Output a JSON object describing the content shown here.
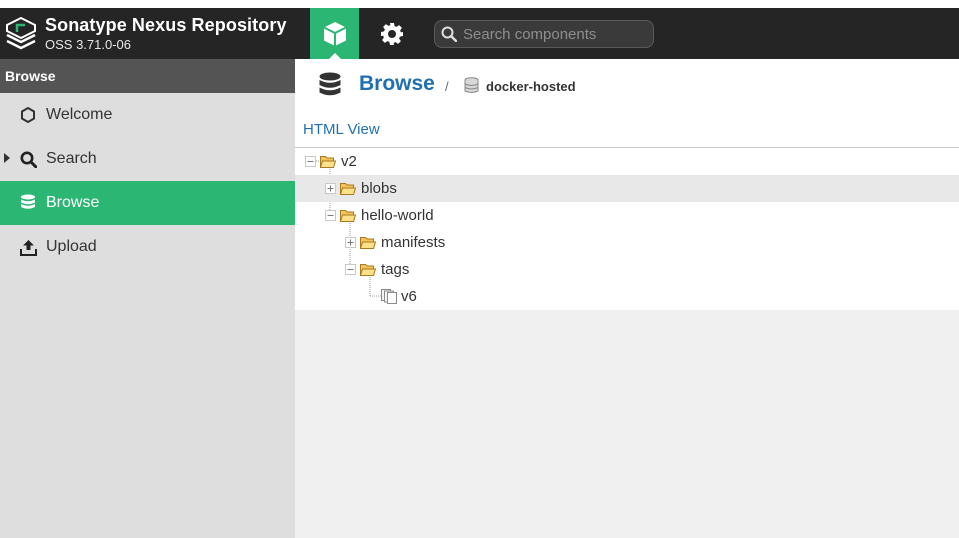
{
  "header": {
    "title": "Sonatype Nexus Repository",
    "version": "OSS 3.71.0-06",
    "search_placeholder": "Search components",
    "brand_color": "#2bb673",
    "icons": [
      "sonatype-logo",
      "cube-icon",
      "gear-icon",
      "search-icon"
    ]
  },
  "sidebar": {
    "header": "Browse",
    "items": [
      {
        "label": "Welcome",
        "icon": "hexagon-icon",
        "active": false
      },
      {
        "label": "Search",
        "icon": "search-icon",
        "active": false,
        "expandable": true
      },
      {
        "label": "Browse",
        "icon": "database-icon",
        "active": true
      },
      {
        "label": "Upload",
        "icon": "upload-icon",
        "active": false
      }
    ]
  },
  "breadcrumb": {
    "title": "Browse",
    "separator": "/",
    "repository": "docker-hosted"
  },
  "html_view_label": "HTML View",
  "tree": [
    {
      "label": "v2",
      "level": 0,
      "type": "folder",
      "expanded": true
    },
    {
      "label": "blobs",
      "level": 1,
      "type": "folder",
      "expanded": false,
      "hover": true
    },
    {
      "label": "hello-world",
      "level": 1,
      "type": "folder",
      "expanded": true
    },
    {
      "label": "manifests",
      "level": 2,
      "type": "folder",
      "expanded": false
    },
    {
      "label": "tags",
      "level": 2,
      "type": "folder",
      "expanded": true
    },
    {
      "label": "v6",
      "level": 3,
      "type": "file"
    }
  ]
}
